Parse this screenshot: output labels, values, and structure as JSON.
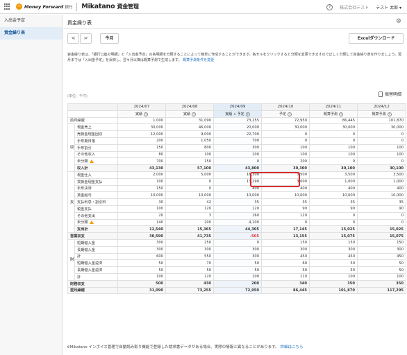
{
  "header": {
    "brand": "Money Forward",
    "brand_sub": "銀行",
    "app_name": "Mikatano",
    "app_name_ja": "資金管理",
    "help_icon_glyph": "?",
    "company": "株式会社テスト",
    "user": "テスト 太郎 ▾"
  },
  "sidebar": {
    "items": [
      {
        "label": "入出金予定"
      },
      {
        "label": "資金繰り表"
      }
    ]
  },
  "main": {
    "title": "資金繰り表",
    "prev": "<",
    "next": ">",
    "today": "今月",
    "excel": "Excelダウンロード",
    "description": "資金繰り表は、「銀行口座の明細」と「入出金予定」の各明細を分類することによって簡単に作成することができます。各セルをクリックすると分類を変更できますので正しく分類して資金繰り表を作りましょう。翌月までは「入出金予定」を反映し、翌々月以降は概算予測で生成します。",
    "description_link": "概算予測条件を変更",
    "unit": "(単位：千円)",
    "detail": "振替明細",
    "footer": "※Mikatano インボイス管理で自動読み取り機能で登録した請求書データがある場合、実際の情報と異なることがあります。",
    "footer_link": "詳細はこちら"
  },
  "table": {
    "months": [
      "2024/07",
      "2024/08",
      "2024/09",
      "2024/10",
      "2024/11",
      "2024/12"
    ],
    "statuses": [
      "実績",
      "実績",
      "実績 + 予定",
      "予定",
      "概算予測",
      "概算予測"
    ],
    "sections": {
      "income": "収入",
      "expense": "支出",
      "finance": "財務"
    },
    "rows": {
      "r0": {
        "label": "前月繰越",
        "v": [
          "1,000",
          "31,090",
          "73,255",
          "72,950",
          "86,445",
          "101,870"
        ]
      },
      "r1": {
        "label": "現金売上",
        "v": [
          "30,000",
          "46,000",
          "20,000",
          "30,000",
          "30,000",
          "30,000"
        ]
      },
      "r2": {
        "label": "売掛金現金回収",
        "v": [
          "12,000",
          "9,000",
          "22,700",
          "0",
          "0",
          "0"
        ]
      },
      "r3": {
        "label": "手形期日落",
        "v": [
          "200",
          "1,050",
          "700",
          "0",
          "0",
          "0"
        ]
      },
      "r4": {
        "label": "手形割引",
        "v": [
          "150",
          "800",
          "300",
          "100",
          "100",
          "100"
        ]
      },
      "r5": {
        "label": "その他収入",
        "v": [
          "80",
          "100",
          "100",
          "100",
          "100",
          "100"
        ]
      },
      "r6": {
        "label": "未分類",
        "v": [
          "700",
          "150",
          "0",
          "200",
          "0",
          "0"
        ]
      },
      "r7": {
        "label": "収入計",
        "v": [
          "43,130",
          "57,100",
          "43,800",
          "30,300",
          "30,100",
          "30,100"
        ]
      },
      "r8": {
        "label": "現金仕入",
        "v": [
          "2,000",
          "5,000",
          "16,300",
          "3,500",
          "3,500",
          "3,500"
        ]
      },
      "r9": {
        "label": "買掛金現金支払",
        "v": [
          "100",
          "0",
          "13,190",
          "3,000",
          "1,000",
          "1,000"
        ]
      },
      "r10": {
        "label": "手形決済",
        "v": [
          "150",
          "0",
          "400",
          "400",
          "400",
          "400"
        ]
      },
      "r11": {
        "label": "賃金給与",
        "v": [
          "10,000",
          "10,000",
          "10,000",
          "10,000",
          "10,000",
          "10,000"
        ]
      },
      "r12": {
        "label": "支払利息・割引料",
        "v": [
          "30",
          "42",
          "35",
          "35",
          "35",
          "35"
        ]
      },
      "r13": {
        "label": "税金支払",
        "v": [
          "100",
          "120",
          "120",
          "90",
          "90",
          "90"
        ]
      },
      "r14": {
        "label": "その他支出",
        "v": [
          "20",
          "3",
          "160",
          "120",
          "0",
          "0"
        ]
      },
      "r15": {
        "label": "未分類",
        "v": [
          "140",
          "200",
          "4,100",
          "0",
          "0",
          "0"
        ]
      },
      "r16": {
        "label": "支出計",
        "v": [
          "12,540",
          "15,365",
          "44,305",
          "17,145",
          "15,025",
          "15,025"
        ]
      },
      "r17": {
        "label": "営業収支",
        "v": [
          "30,590",
          "41,735",
          "-505",
          "13,155",
          "15,075",
          "15,075"
        ]
      },
      "r18": {
        "label": "短期借入金",
        "v": [
          "300",
          "250",
          "0",
          "150",
          "150",
          "150"
        ]
      },
      "r19": {
        "label": "長期借入金",
        "v": [
          "300",
          "300",
          "300",
          "300",
          "300",
          "300"
        ]
      },
      "r20": {
        "label": "計",
        "v": [
          "600",
          "550",
          "300",
          "450",
          "450",
          "450"
        ]
      },
      "r21": {
        "label": "短期借入金返済",
        "v": [
          "50",
          "70",
          "50",
          "60",
          "50",
          "50"
        ]
      },
      "r22": {
        "label": "長期借入金返済",
        "v": [
          "50",
          "50",
          "50",
          "50",
          "50",
          "50"
        ]
      },
      "r23": {
        "label": "計",
        "v": [
          "100",
          "120",
          "100",
          "110",
          "100",
          "100"
        ]
      },
      "r24": {
        "label": "財務収支",
        "v": [
          "500",
          "430",
          "200",
          "340",
          "350",
          "350"
        ]
      },
      "r25": {
        "label": "翌月繰越",
        "v": [
          "31,090",
          "73,255",
          "72,950",
          "86,445",
          "101,870",
          "117,295"
        ]
      }
    }
  },
  "colors": {
    "accent": "#1a6fc4",
    "highlight": "#d32f2f",
    "negative": "#e0302f",
    "current_month": "#e3edf7"
  }
}
